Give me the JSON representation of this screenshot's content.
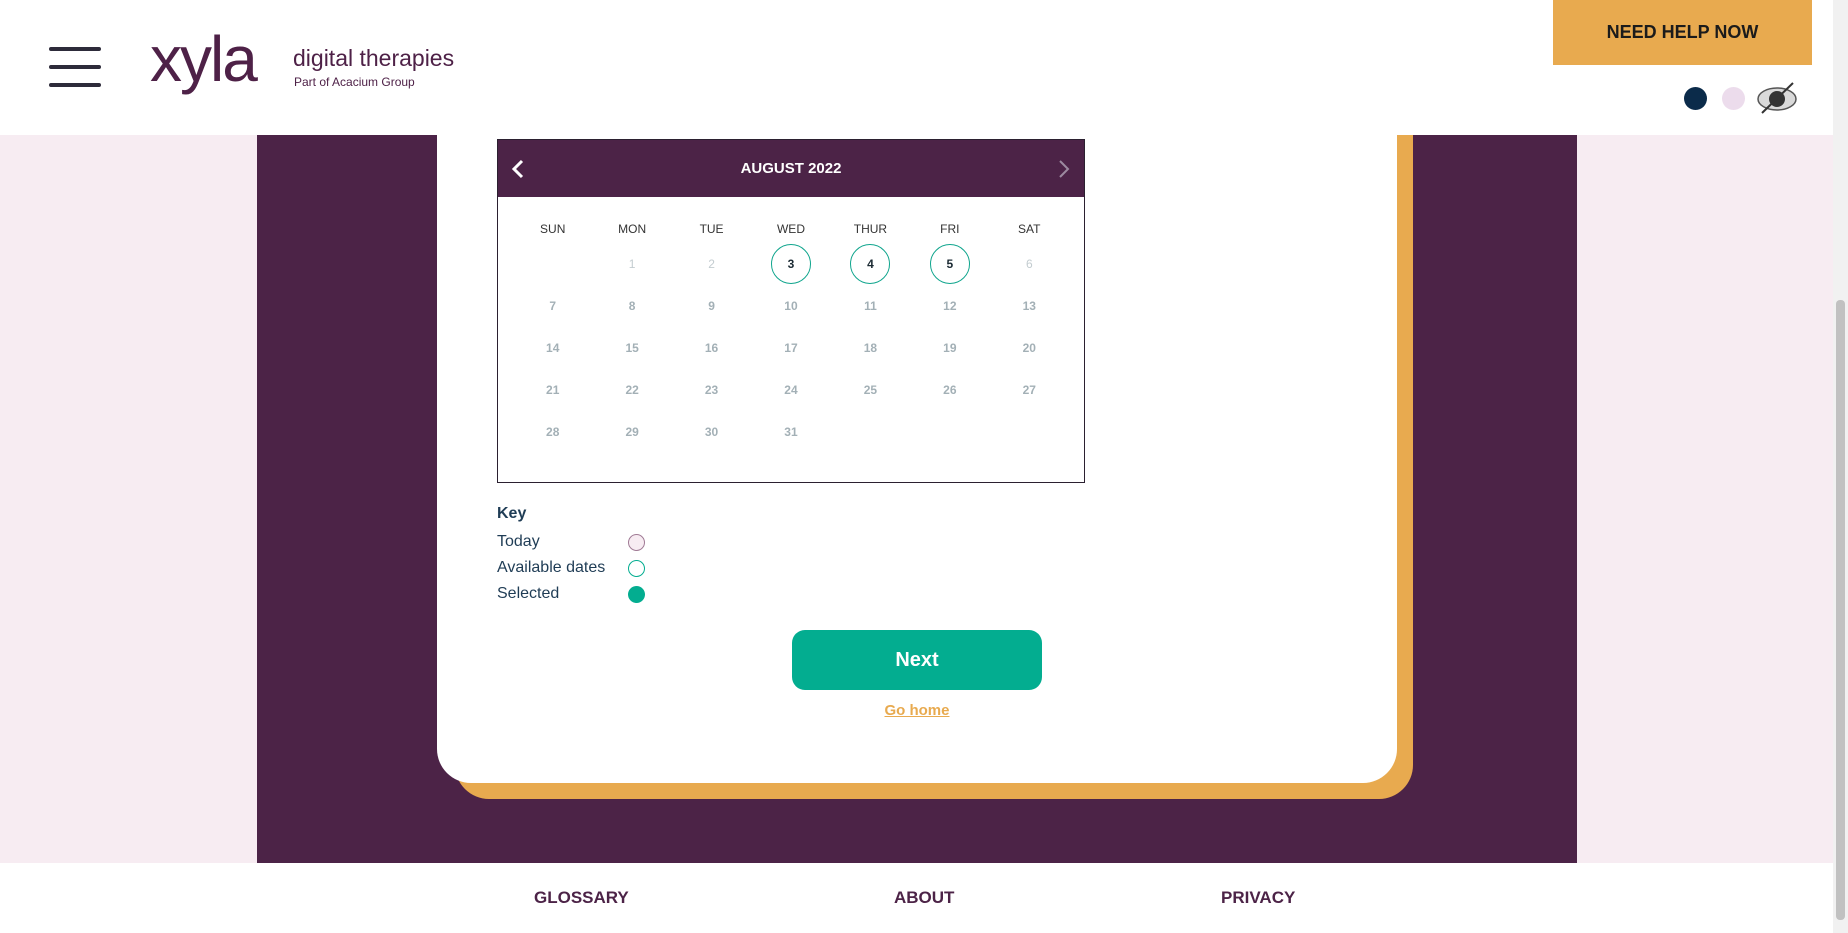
{
  "header": {
    "logo_word": "xyla",
    "logo_tagline": "digital therapies",
    "logo_subtitle": "Part of Acacium Group",
    "help_button": "NEED HELP NOW",
    "theme_colors": [
      "#0b2b4a",
      "#ecdcec"
    ]
  },
  "calendar": {
    "month_label": "AUGUST 2022",
    "weekdays": [
      "SUN",
      "MON",
      "TUE",
      "WED",
      "THUR",
      "FRI",
      "SAT"
    ],
    "leading_blanks": 1,
    "days": [
      "1",
      "2",
      "3",
      "4",
      "5",
      "6",
      "7",
      "8",
      "9",
      "10",
      "11",
      "12",
      "13",
      "14",
      "15",
      "16",
      "17",
      "18",
      "19",
      "20",
      "21",
      "22",
      "23",
      "24",
      "25",
      "26",
      "27",
      "28",
      "29",
      "30",
      "31"
    ],
    "available_days": [
      "3",
      "4",
      "5"
    ],
    "faded_days": [
      "1",
      "2",
      "6"
    ]
  },
  "key": {
    "title": "Key",
    "today": "Today",
    "available": "Available dates",
    "selected": "Selected"
  },
  "actions": {
    "next": "Next",
    "go_home": "Go home"
  },
  "footer": {
    "glossary": "GLOSSARY",
    "about": "ABOUT",
    "privacy": "PRIVACY"
  },
  "colors": {
    "brand_purple": "#4c2347",
    "accent_orange": "#e8aa4f",
    "teal": "#03ad90"
  }
}
